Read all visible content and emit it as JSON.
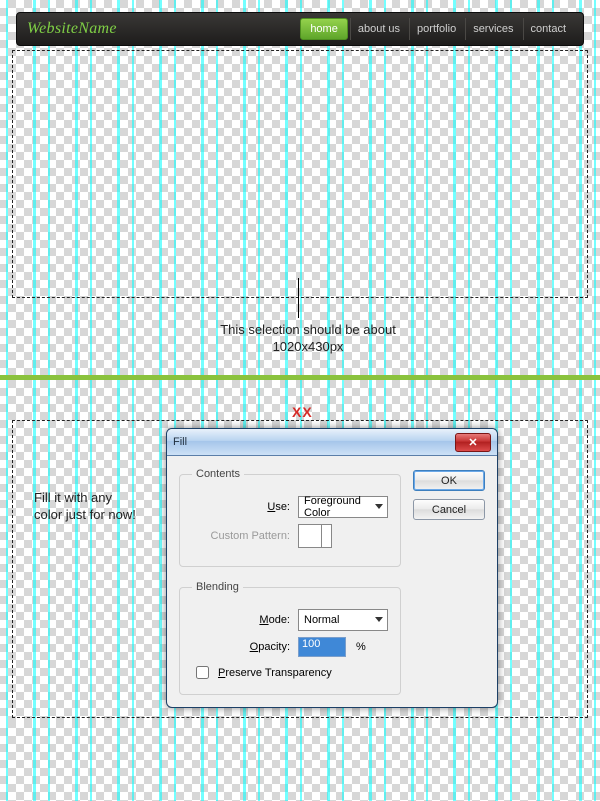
{
  "header": {
    "logo": "WebsiteName",
    "nav": [
      "home",
      "about us",
      "portfolio",
      "services",
      "contact"
    ],
    "active_index": 0
  },
  "annotations": {
    "selection_note": "This selection should be about 1020x430px",
    "red_marker": "XX",
    "fill_note": "Fill it with any color just for now!"
  },
  "dialog": {
    "title": "Fill",
    "close_glyph": "✕",
    "contents_legend": "Contents",
    "use_label": "Use:",
    "use_value": "Foreground Color",
    "pattern_label": "Custom Pattern:",
    "blending_legend": "Blending",
    "mode_label": "Mode:",
    "mode_value": "Normal",
    "opacity_label": "Opacity:",
    "opacity_value": "100",
    "opacity_unit": "%",
    "preserve_label": "Preserve Transparency",
    "ok_label": "OK",
    "cancel_label": "Cancel"
  }
}
